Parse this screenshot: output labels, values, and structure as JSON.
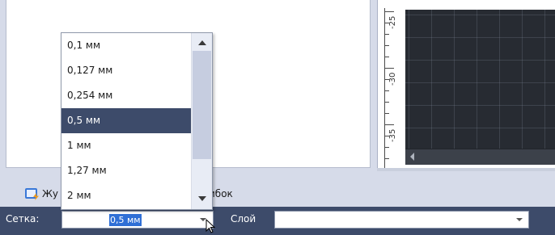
{
  "tabs": {
    "journal_label": "Жу",
    "errors_label": "ибок"
  },
  "toolbar": {
    "grid_label": "Сетка:",
    "grid_value": "0,5 мм",
    "layer_label": "Слой",
    "layer_value": ""
  },
  "ruler": {
    "labels": [
      "-25",
      "-30",
      "-35"
    ]
  },
  "dropdown": {
    "items": [
      "0,1 мм",
      "0,127 мм",
      "0,254 мм",
      "0,5 мм",
      "1 мм",
      "1,27 мм",
      "2 мм"
    ],
    "selected_index": 3,
    "scroll_position_fraction": 0.0
  },
  "colors": {
    "toolbar_bg": "#3d4b6a",
    "selected_item_bg": "#3d4b6a",
    "canvas_bg": "#272b32",
    "text_highlight": "#2f6fd6"
  }
}
